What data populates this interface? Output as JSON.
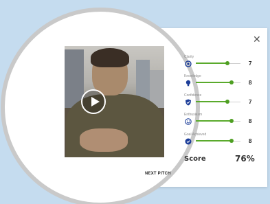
{
  "panel": {
    "close_label": "✕",
    "next_pitch_label": "NEXT PITCH"
  },
  "metrics": [
    {
      "label": "Clarity",
      "icon": "target-icon",
      "value": "7",
      "slider_fraction": 0.7
    },
    {
      "label": "Knowledge",
      "icon": "lightbulb-icon",
      "value": "8",
      "slider_fraction": 0.8
    },
    {
      "label": "Confidence",
      "icon": "shield-icon",
      "value": "7",
      "slider_fraction": 0.7
    },
    {
      "label": "Enthusiasm",
      "icon": "smiley-icon",
      "value": "8",
      "slider_fraction": 0.8
    },
    {
      "label": "Goal Achieved",
      "icon": "badge-check-icon",
      "value": "8",
      "slider_fraction": 0.8
    }
  ],
  "score": {
    "label": "Score",
    "value": "76%"
  },
  "colors": {
    "accent_green": "#5aaa2c",
    "icon_blue": "#1d3e99",
    "background": "#c5dcef"
  }
}
